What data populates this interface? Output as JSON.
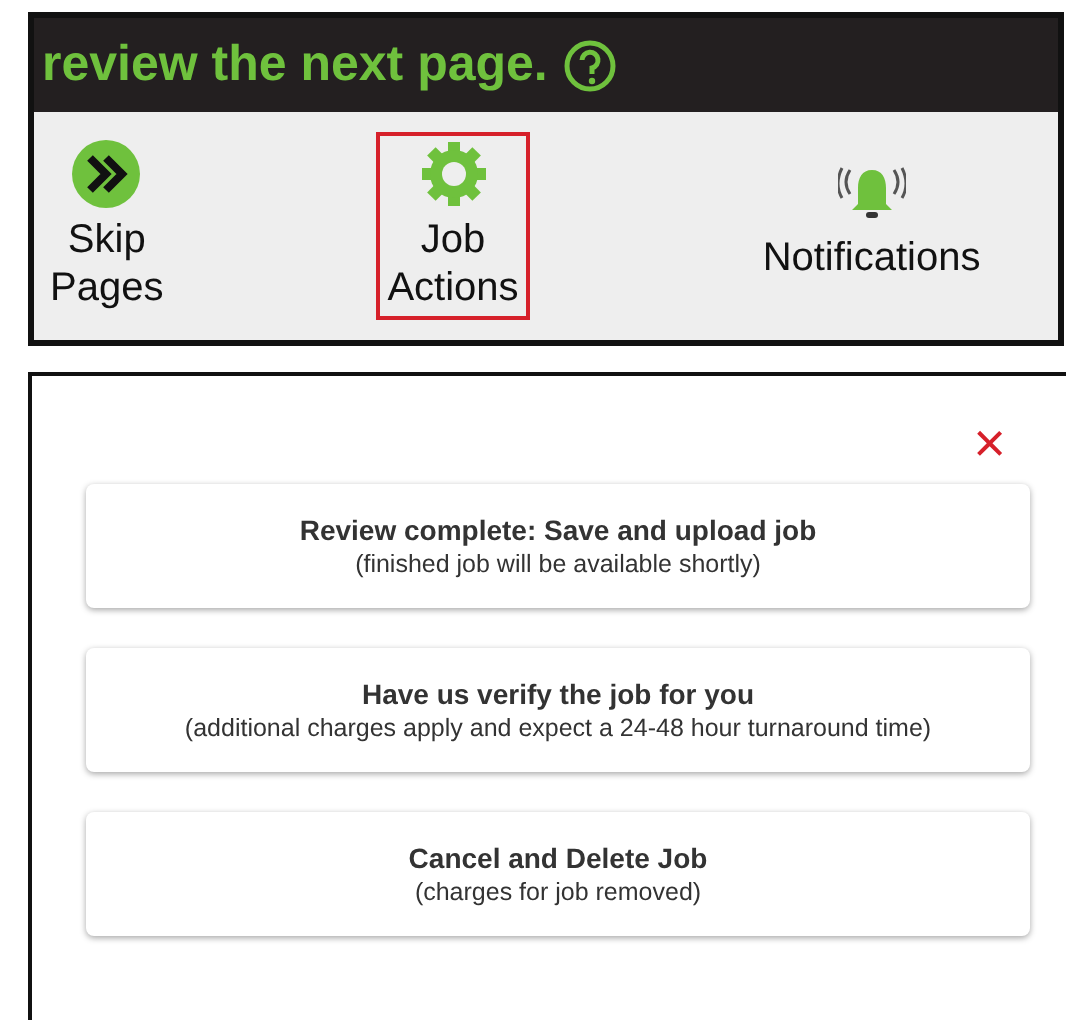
{
  "header": {
    "title": "review the next page."
  },
  "toolbar": {
    "items": [
      {
        "label": "Skip Pages",
        "selected": false
      },
      {
        "label": "Job Actions",
        "selected": true
      },
      {
        "label": "Notifications",
        "selected": false
      }
    ]
  },
  "dialog": {
    "close": "×",
    "actions": [
      {
        "title": "Review complete: Save and upload job",
        "subtitle": "(finished job will be available shortly)"
      },
      {
        "title": "Have us verify the job for you",
        "subtitle": "(additional charges apply and expect a 24-48 hour turnaround time)"
      },
      {
        "title": "Cancel and Delete Job",
        "subtitle": "(charges for job removed)"
      }
    ]
  }
}
